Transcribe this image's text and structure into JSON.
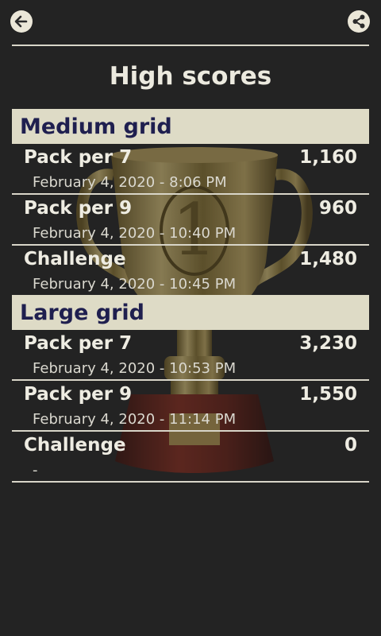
{
  "header": {
    "back_icon": "arrow-left-icon",
    "share_icon": "share-icon",
    "title": "High scores"
  },
  "sections": [
    {
      "title": "Medium grid",
      "rows": [
        {
          "name": "Pack per 7",
          "score": "1,160",
          "date": "February 4, 2020 - 8:06 PM"
        },
        {
          "name": "Pack per 9",
          "score": "960",
          "date": "February 4, 2020 - 10:40 PM"
        },
        {
          "name": "Challenge",
          "score": "1,480",
          "date": "February 4, 2020 - 10:45 PM"
        }
      ]
    },
    {
      "title": "Large grid",
      "rows": [
        {
          "name": "Pack per 7",
          "score": "3,230",
          "date": "February 4, 2020 - 10:53 PM"
        },
        {
          "name": "Pack per 9",
          "score": "1,550",
          "date": "February 4, 2020 - 11:14 PM"
        },
        {
          "name": "Challenge",
          "score": "0",
          "date": "-"
        }
      ]
    }
  ],
  "colors": {
    "background": "#232323",
    "section_bg": "#dedbc6",
    "section_text": "#1f1f4f",
    "text": "#eeece2"
  }
}
